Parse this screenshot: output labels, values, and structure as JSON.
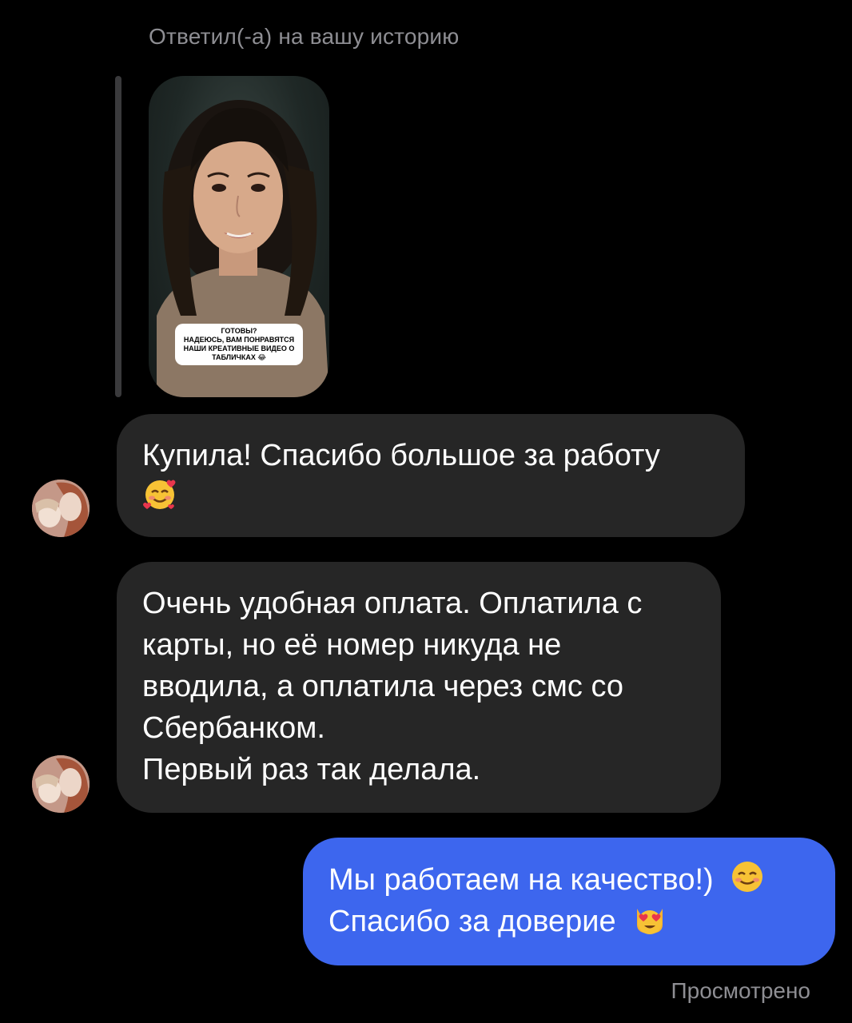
{
  "reply": {
    "caption": "Ответил(-а) на вашу историю",
    "story_sticker": {
      "line1": "ГОТОВЫ?",
      "line2": "НАДЕЮСЬ, ВАМ ПОНРАВЯТСЯ",
      "line3": "НАШИ КРЕАТИВНЫЕ ВИДЕО О",
      "line4": "ТАБЛИЧКАХ 😂"
    }
  },
  "messages": [
    {
      "direction": "incoming",
      "lines": [
        "Купила! Спасибо большое за работу",
        ""
      ],
      "emoji": "smiling-face-with-hearts-icon"
    },
    {
      "direction": "incoming",
      "lines": [
        "Очень удобная оплата. Оплатила с",
        "карты, но её номер никуда не",
        "вводила, а оплатила через смс со",
        "Сбербанком.",
        "Первый раз так делала."
      ]
    },
    {
      "direction": "outgoing",
      "lines": [
        "Мы работаем на качество!)",
        "Спасибо за доверие"
      ],
      "emojis": [
        "smiling-face-icon",
        "heart-eyes-cat-icon"
      ]
    }
  ],
  "status": {
    "seen": "Просмотрено"
  },
  "colors": {
    "background": "#000000",
    "incoming_bubble": "#262626",
    "outgoing_bubble": "#3d66ee",
    "meta_text": "#8e8e93"
  }
}
